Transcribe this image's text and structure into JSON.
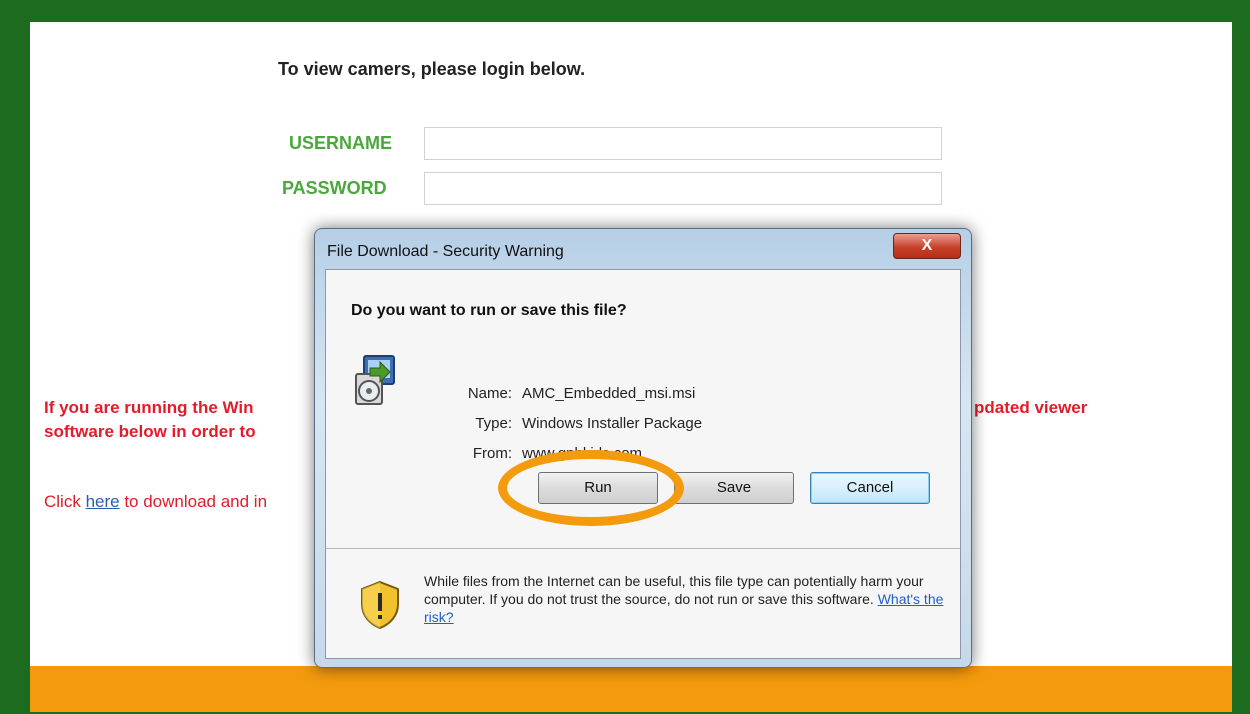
{
  "page": {
    "heading": "To view camers, please login below.",
    "username_label": "USERNAME",
    "password_label": "PASSWORD",
    "username_value": "",
    "password_value": "",
    "warning_line1_left": "If you are running the Win",
    "warning_line1_right": "pdated viewer",
    "warning_line2_left": "software below in order to",
    "click_prefix": "Click ",
    "click_link": "here",
    "click_suffix": " to download and in"
  },
  "dialog": {
    "title": "File Download - Security Warning",
    "close_label": "X",
    "question": "Do you want to run or save this file?",
    "fields": [
      {
        "key": "Name:",
        "value": "AMC_Embedded_msi.msi"
      },
      {
        "key": "Type:",
        "value": "Windows Installer Package"
      },
      {
        "key": "From:",
        "value": "www.gnbkids.com"
      }
    ],
    "buttons": {
      "run": "Run",
      "save": "Save",
      "cancel": "Cancel"
    },
    "footer_text": "While files from the Internet can be useful, this file type can potentially harm your computer. If you do not trust the source, do not run or save this software.",
    "footer_link": "What's the risk?",
    "icons": {
      "installer": "installer-package-icon",
      "shield": "shield-warning-icon"
    }
  },
  "colors": {
    "frame": "#1d6b1f",
    "label_green": "#4aa83b",
    "warning_red": "#e21c2a",
    "highlight_orange": "#f49a0d",
    "bar_orange": "#f49a0d"
  }
}
